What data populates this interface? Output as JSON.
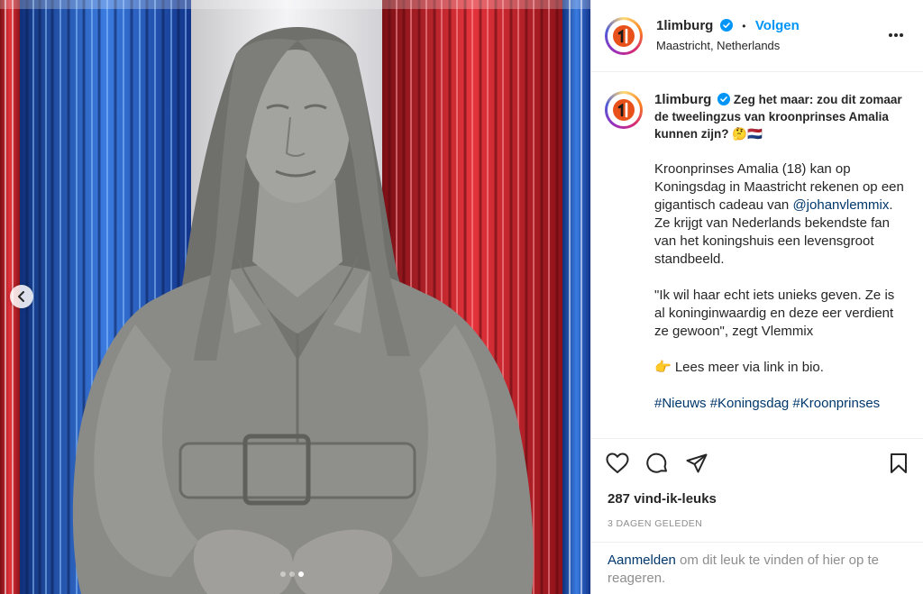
{
  "post": {
    "username": "1limburg",
    "follow_label": "Volgen",
    "separator": "•",
    "location": "Maastricht, Netherlands",
    "more_icon": "more-horizontal-icon",
    "verified_color": "#0095f6"
  },
  "caption": {
    "username": "1limburg",
    "headline": "Zeg het maar: zou dit zomaar de tweelingzus van kroonprinses Amalia kunnen zijn? 🤔🇳🇱",
    "para1_a": "Kroonprinses Amalia (18) kan op Koningsdag in Maastricht rekenen op een gigantisch cadeau van ",
    "para1_mention": "@johanvlemmix",
    "para1_b": ". Ze krijgt van Nederlands bekendste fan van het koningshuis een levensgroot standbeeld.",
    "para2": "\"Ik wil haar echt iets unieks geven. Ze is al koninginwaardig en deze eer verdient ze gewoon\", zegt Vlemmix",
    "para3": "👉 Lees meer via link in bio.",
    "hashtags": "#Nieuws #Koningsdag #Kroonprinses"
  },
  "actions": {
    "icons": [
      "heart-icon",
      "comment-icon",
      "share-icon",
      "bookmark-icon"
    ],
    "likes": "287 vind-ik-leuks",
    "date": "3 DAGEN GELEDEN"
  },
  "login": {
    "link": "Aanmelden",
    "rest": " om dit leuk te vinden of hier op te reageren."
  },
  "carousel": {
    "slide_count": 3,
    "active_slide": 3,
    "prev_icon": "chevron-left-icon"
  },
  "colors": {
    "link": "#00376b",
    "follow": "#0095f6",
    "muted": "#8e8e8e",
    "brand_orange": "#e8521a",
    "flag_red": "#c8232c",
    "flag_blue": "#2a56b8"
  }
}
